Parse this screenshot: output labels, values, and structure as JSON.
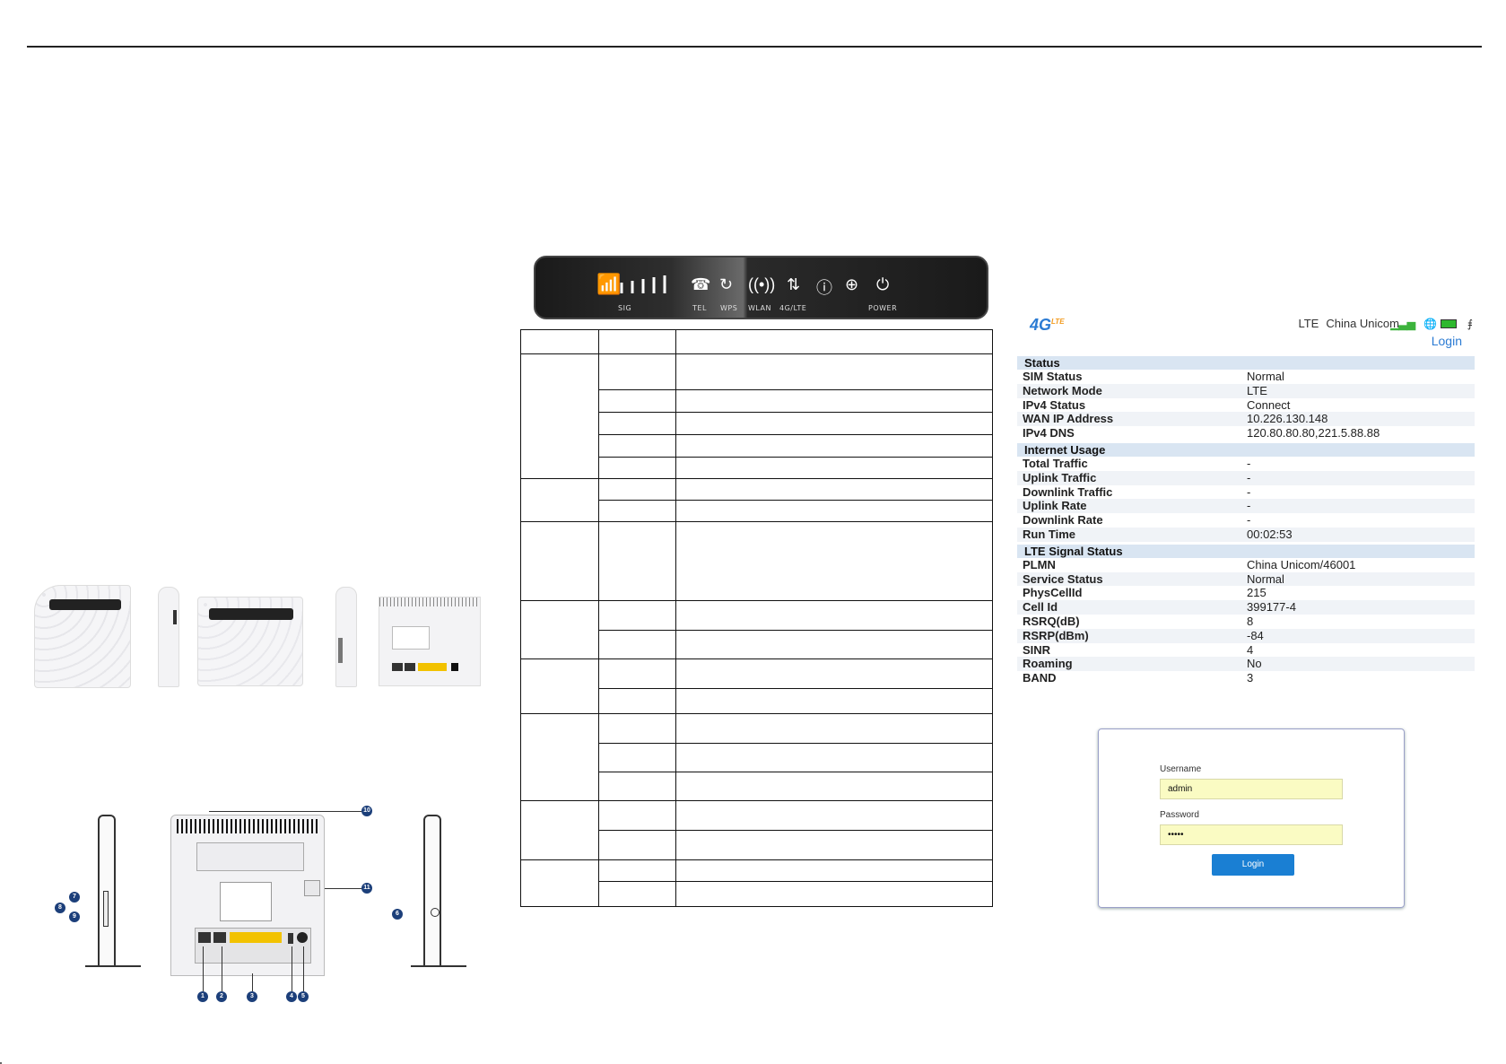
{
  "led_panel": {
    "labels": [
      "SIG",
      "TEL",
      "WPS",
      "WLAN",
      "4G/LTE",
      "POWER"
    ]
  },
  "status_panel": {
    "logo": "4G",
    "logo_sup": "LTE",
    "network_type": "LTE",
    "operator": "China Unicom",
    "login_link": "Login",
    "sections": [
      {
        "title": "Status",
        "rows": [
          {
            "key": "SIM Status",
            "value": "Normal"
          },
          {
            "key": "Network Mode",
            "value": "LTE"
          },
          {
            "key": "IPv4 Status",
            "value": "Connect"
          },
          {
            "key": "WAN IP Address",
            "value": "10.226.130.148"
          },
          {
            "key": "IPv4 DNS",
            "value": "120.80.80.80,221.5.88.88"
          }
        ]
      },
      {
        "title": "Internet Usage",
        "rows": [
          {
            "key": "Total Traffic",
            "value": "-"
          },
          {
            "key": "Uplink Traffic",
            "value": "-"
          },
          {
            "key": "Downlink Traffic",
            "value": "-"
          },
          {
            "key": "Uplink Rate",
            "value": "-"
          },
          {
            "key": "Downlink Rate",
            "value": "-"
          },
          {
            "key": "Run Time",
            "value": "00:02:53"
          }
        ]
      },
      {
        "title": "LTE Signal Status",
        "rows": [
          {
            "key": "PLMN",
            "value": "China Unicom/46001"
          },
          {
            "key": "Service Status",
            "value": "Normal"
          },
          {
            "key": "PhysCellId",
            "value": "215"
          },
          {
            "key": "Cell Id",
            "value": "399177-4"
          },
          {
            "key": "RSRQ(dB)",
            "value": "8"
          },
          {
            "key": "RSRP(dBm)",
            "value": "-84"
          },
          {
            "key": "SINR",
            "value": "4"
          },
          {
            "key": "Roaming",
            "value": "No"
          },
          {
            "key": "BAND",
            "value": "3"
          }
        ]
      }
    ]
  },
  "login_form": {
    "username_label": "Username",
    "username_value": "admin",
    "password_label": "Password",
    "password_value": "•••••",
    "button_label": "Login"
  },
  "callouts": [
    "1",
    "2",
    "3",
    "4",
    "5",
    "6",
    "7",
    "8",
    "9",
    "10",
    "11"
  ],
  "colors": {
    "accent": "#1a7fd3",
    "section_header": "#d9e5f2",
    "input_fill": "#fafbc3",
    "callout": "#1c3f7a"
  }
}
